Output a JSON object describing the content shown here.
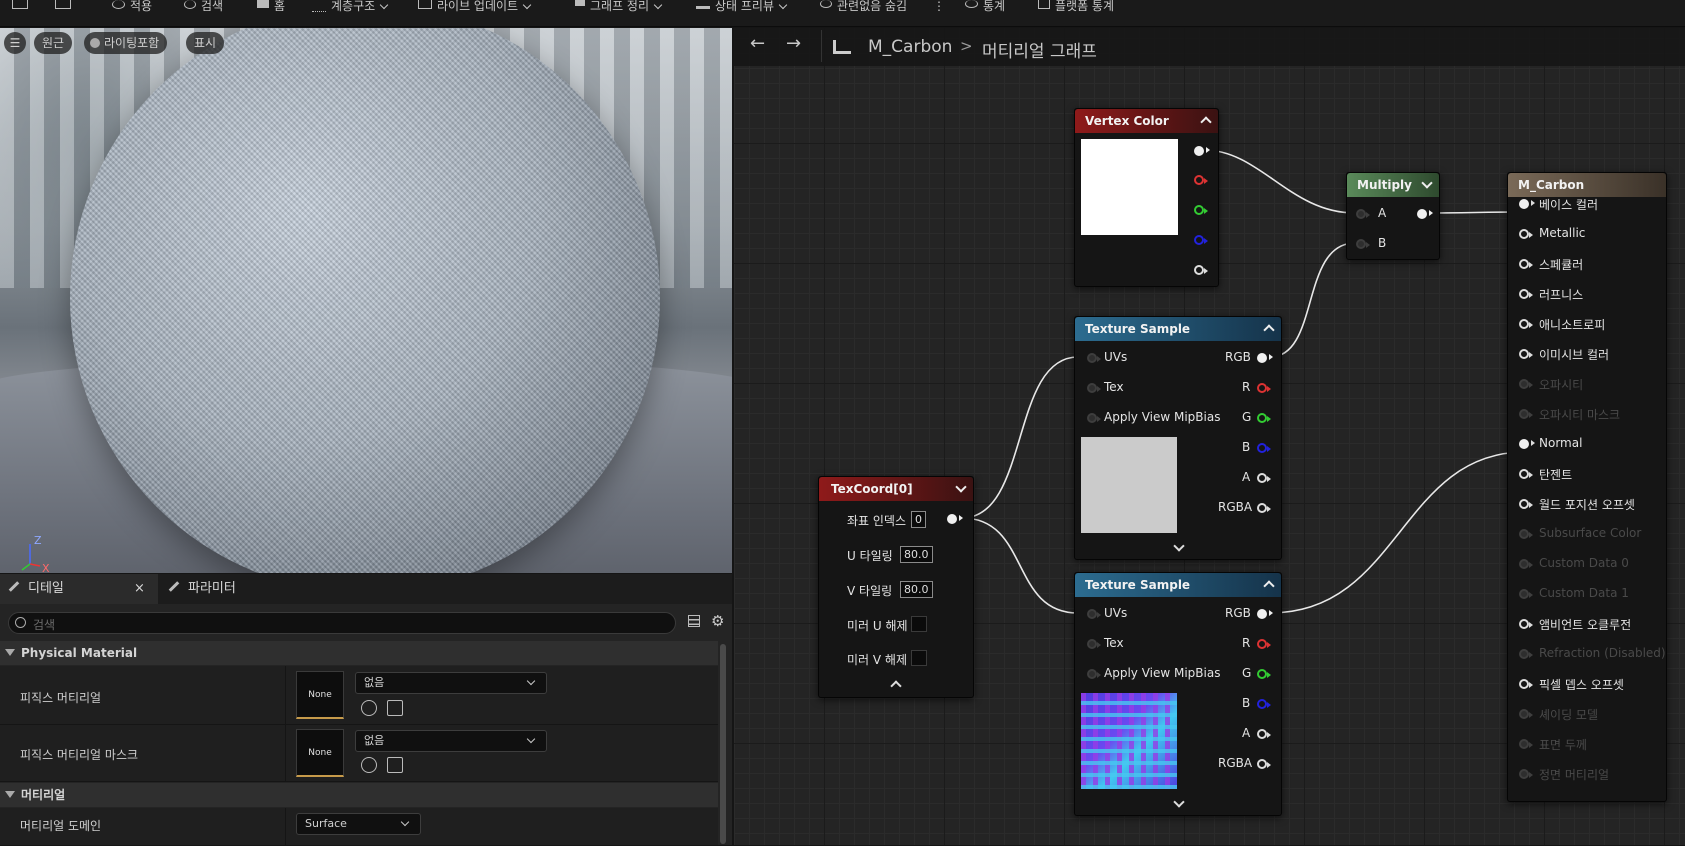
{
  "toolbar": {
    "items": [
      "적용",
      "검색",
      "홈",
      "계층구조",
      "라이브 업데이트",
      "그래프 정리",
      "상태 프리뷰",
      "관련없음 숨김",
      "통계",
      "플랫폼 통계"
    ]
  },
  "viewport": {
    "buttons": [
      "원근",
      "라이팅포함",
      "표시"
    ],
    "axis_z": "Z",
    "axis_x": "X"
  },
  "details": {
    "tab_details": "디테일",
    "tab_close": "×",
    "tab_params": "파라미터",
    "search_placeholder": "검색",
    "section1": "Physical Material",
    "prop1_label": "피직스 머티리얼",
    "prop1_thumb": "None",
    "prop1_value": "없음",
    "prop2_label": "피직스 머티리얼 마스크",
    "prop2_thumb": "None",
    "prop2_value": "없음",
    "section2": "머티리얼",
    "prop3_label": "머티리얼 도메인",
    "prop3_value": "Surface"
  },
  "graph": {
    "breadcrumb_root": "M_Carbon",
    "breadcrumb_sep": ">",
    "breadcrumb_current": "머티리얼 그래프",
    "colors": {
      "vertex_head": "#8f1a1a",
      "texture_head": "#225a78",
      "multiply_head": "#4f7a4f",
      "result_head": "#6a5a48",
      "texcoord_head": "#8f1a1a",
      "normal_tex_a": "#4e3ce0",
      "normal_tex_b": "#40c8f0"
    },
    "vertex_color": {
      "title": "Vertex Color"
    },
    "multiply": {
      "title": "Multiply",
      "a": "A",
      "b": "B"
    },
    "texcoord": {
      "title": "TexCoord[0]",
      "index_label": "좌표 인덱스",
      "index_value": "0",
      "u_label": "U 타일링",
      "u_value": "80.0",
      "v_label": "V 타일링",
      "v_value": "80.0",
      "mirror_u": "미러 U 해제",
      "mirror_v": "미러 V 해제"
    },
    "texture1": {
      "title": "Texture Sample",
      "inputs": [
        "UVs",
        "Tex",
        "Apply View MipBias"
      ],
      "outputs": [
        "RGB",
        "R",
        "G",
        "B",
        "A",
        "RGBA"
      ]
    },
    "texture2": {
      "title": "Texture Sample",
      "inputs": [
        "UVs",
        "Tex",
        "Apply View MipBias"
      ],
      "outputs": [
        "RGB",
        "R",
        "G",
        "B",
        "A",
        "RGBA"
      ]
    },
    "result": {
      "title": "M_Carbon",
      "inputs": [
        "베이스 컬러",
        "Metallic",
        "스페큘러",
        "러프니스",
        "애니소트로피",
        "이미시브 컬러",
        "오파시티",
        "오파시티 마스크",
        "Normal",
        "탄젠트",
        "월드 포지션 오프셋",
        "Subsurface Color",
        "Custom Data 0",
        "Custom Data 1",
        "앰비언트 오클루전",
        "Refraction (Disabled)",
        "픽셀 뎁스 오프셋",
        "셰이딩 모델",
        "표면 두께",
        "정면 머티리얼"
      ],
      "enabled": [
        true,
        true,
        true,
        true,
        true,
        true,
        false,
        false,
        true,
        true,
        true,
        false,
        false,
        false,
        true,
        false,
        true,
        false,
        false,
        false
      ]
    }
  }
}
